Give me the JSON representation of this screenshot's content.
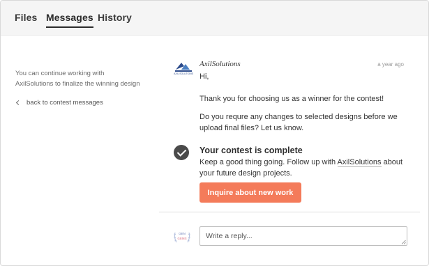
{
  "tabs": [
    {
      "label": "Files",
      "active": false
    },
    {
      "label": "Messages",
      "active": true
    },
    {
      "label": "History",
      "active": false
    }
  ],
  "sidebar": {
    "info": "You can continue working with AxilSolutions to finalize the winning design",
    "back_link": "back to contest messages"
  },
  "message": {
    "sender": "AxilSolutions",
    "time": "a year ago",
    "logo_text": "AXIL SOLUTIONS",
    "greeting": "Hi,",
    "paragraph1": "Thank you for choosing us as a winner for the contest!",
    "paragraph2": "Do you requre any changes to selected designs before we upload final files? Let us know."
  },
  "complete": {
    "title": "Your contest is complete",
    "desc_before": "Keep a good thing going. Follow up with ",
    "desc_link": "AxilSolutions",
    "desc_after": " about your future design projects.",
    "button": "Inquire about new work"
  },
  "reply": {
    "avatar_text_top": "GEN",
    "avatar_text_bottom": "GEMS",
    "placeholder": "Write a reply..."
  },
  "colors": {
    "accent": "#f47b5a",
    "tab_bar": "#f5f5f5",
    "check_icon": "#4a4a4a",
    "logo_blue": "#2b4a8a"
  }
}
